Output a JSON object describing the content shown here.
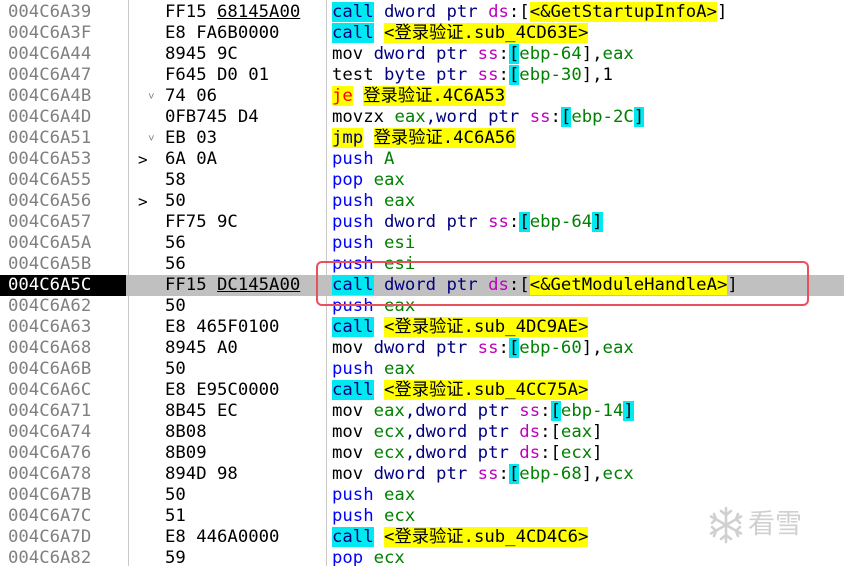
{
  "rows": [
    {
      "addr": "004C6A39",
      "mark": "",
      "bytes": [
        {
          "t": "FF15 "
        },
        {
          "t": "68145A00",
          "u": true
        }
      ],
      "dis": [
        {
          "c": "call",
          "s": "t-call"
        },
        {
          "c": " dword ptr ",
          "s": "t-ptr"
        },
        {
          "c": "ds",
          "s": "t-seg"
        },
        {
          "c": ":[",
          "s": "t-bkt"
        },
        {
          "c": "<&GetStartupInfoA>",
          "s": "t-sym"
        },
        {
          "c": "]",
          "s": "t-bkt"
        }
      ]
    },
    {
      "addr": "004C6A3F",
      "mark": "",
      "bytes": [
        {
          "t": "E8 FA6B0000"
        }
      ],
      "dis": [
        {
          "c": "call",
          "s": "t-call"
        },
        {
          "c": " ",
          "s": "t-plain"
        },
        {
          "c": "<登录验证.sub_4CD63E>",
          "s": "t-sym"
        }
      ]
    },
    {
      "addr": "004C6A44",
      "mark": "",
      "bytes": [
        {
          "t": "8945 9C"
        }
      ],
      "dis": [
        {
          "c": "mov",
          "s": "t-mov"
        },
        {
          "c": " dword ptr ",
          "s": "t-ptr"
        },
        {
          "c": "ss",
          "s": "t-seg"
        },
        {
          "c": ":",
          "s": "t-bkt"
        },
        {
          "c": "[",
          "s": "t-cyanbkt"
        },
        {
          "c": "ebp-64",
          "s": "t-reg"
        },
        {
          "c": "]",
          "s": "t-bkt"
        },
        {
          "c": ",",
          "s": "t-plain"
        },
        {
          "c": "eax",
          "s": "t-reg"
        }
      ]
    },
    {
      "addr": "004C6A47",
      "mark": "",
      "bytes": [
        {
          "t": "F645 D0 01"
        }
      ],
      "dis": [
        {
          "c": "test",
          "s": "t-test"
        },
        {
          "c": " byte ptr ",
          "s": "t-ptr"
        },
        {
          "c": "ss",
          "s": "t-seg"
        },
        {
          "c": ":",
          "s": "t-bkt"
        },
        {
          "c": "[",
          "s": "t-cyanbkt"
        },
        {
          "c": "ebp-30",
          "s": "t-reg"
        },
        {
          "c": "]",
          "s": "t-bkt"
        },
        {
          "c": ",1",
          "s": "t-plain"
        }
      ]
    },
    {
      "addr": "004C6A4B",
      "mark": "˅",
      "markcls": "jmpmark",
      "bytes": [
        {
          "t": "74 06"
        }
      ],
      "dis": [
        {
          "c": "je",
          "s": "t-je"
        },
        {
          "c": " ",
          "s": "t-plain"
        },
        {
          "c": "登录验证.4C6A53",
          "s": "t-sym"
        }
      ]
    },
    {
      "addr": "004C6A4D",
      "mark": "",
      "bytes": [
        {
          "t": "0FB745 D4"
        }
      ],
      "dis": [
        {
          "c": "movzx",
          "s": "t-mov"
        },
        {
          "c": " ",
          "s": "t-plain"
        },
        {
          "c": "eax",
          "s": "t-reg"
        },
        {
          "c": ",word ptr ",
          "s": "t-ptr"
        },
        {
          "c": "ss",
          "s": "t-seg"
        },
        {
          "c": ":",
          "s": "t-bkt"
        },
        {
          "c": "[",
          "s": "t-cyanbkt"
        },
        {
          "c": "ebp-2C",
          "s": "t-reg"
        },
        {
          "c": "]",
          "s": "t-cyanbkt"
        }
      ]
    },
    {
      "addr": "004C6A51",
      "mark": "˅",
      "markcls": "jmpmark",
      "bytes": [
        {
          "t": "EB 03"
        }
      ],
      "dis": [
        {
          "c": "jmp",
          "s": "t-jmp"
        },
        {
          "c": " ",
          "s": "t-plain"
        },
        {
          "c": "登录验证.4C6A56",
          "s": "t-sym"
        }
      ]
    },
    {
      "addr": "004C6A53",
      "mark": ">",
      "markcls": "target",
      "bytes": [
        {
          "t": "6A 0A"
        }
      ],
      "dis": [
        {
          "c": "push",
          "s": "t-push"
        },
        {
          "c": " ",
          "s": "t-plain"
        },
        {
          "c": "A",
          "s": "t-reg"
        }
      ]
    },
    {
      "addr": "004C6A55",
      "mark": "",
      "bytes": [
        {
          "t": "58"
        }
      ],
      "dis": [
        {
          "c": "pop",
          "s": "t-pop"
        },
        {
          "c": " ",
          "s": "t-plain"
        },
        {
          "c": "eax",
          "s": "t-reg"
        }
      ]
    },
    {
      "addr": "004C6A56",
      "mark": ">",
      "markcls": "target",
      "bytes": [
        {
          "t": "50"
        }
      ],
      "dis": [
        {
          "c": "push",
          "s": "t-push"
        },
        {
          "c": " ",
          "s": "t-plain"
        },
        {
          "c": "eax",
          "s": "t-reg"
        }
      ]
    },
    {
      "addr": "004C6A57",
      "mark": "",
      "bytes": [
        {
          "t": "FF75 9C"
        }
      ],
      "dis": [
        {
          "c": "push",
          "s": "t-push"
        },
        {
          "c": " dword ptr ",
          "s": "t-ptr"
        },
        {
          "c": "ss",
          "s": "t-seg"
        },
        {
          "c": ":",
          "s": "t-bkt"
        },
        {
          "c": "[",
          "s": "t-cyanbkt"
        },
        {
          "c": "ebp-64",
          "s": "t-reg"
        },
        {
          "c": "]",
          "s": "t-cyanbkt"
        }
      ]
    },
    {
      "addr": "004C6A5A",
      "mark": "",
      "bytes": [
        {
          "t": "56"
        }
      ],
      "dis": [
        {
          "c": "push",
          "s": "t-push"
        },
        {
          "c": " ",
          "s": "t-plain"
        },
        {
          "c": "esi",
          "s": "t-reg"
        }
      ]
    },
    {
      "addr": "004C6A5B",
      "mark": "",
      "bytes": [
        {
          "t": "56"
        }
      ],
      "dis": [
        {
          "c": "push",
          "s": "t-push"
        },
        {
          "c": " ",
          "s": "t-plain"
        },
        {
          "c": "esi",
          "s": "t-reg"
        }
      ]
    },
    {
      "addr": "004C6A5C",
      "mark": "",
      "current": true,
      "bytes": [
        {
          "t": "FF15 "
        },
        {
          "t": "DC145A00",
          "u": true
        }
      ],
      "dis": [
        {
          "c": "call",
          "s": "t-call"
        },
        {
          "c": " dword ptr ",
          "s": "t-ptr"
        },
        {
          "c": "ds",
          "s": "t-seg"
        },
        {
          "c": ":[",
          "s": "t-bkt"
        },
        {
          "c": "<&GetModuleHandleA>",
          "s": "t-sym"
        },
        {
          "c": "]",
          "s": "t-bkt"
        }
      ]
    },
    {
      "addr": "004C6A62",
      "mark": "",
      "bytes": [
        {
          "t": "50"
        }
      ],
      "dis": [
        {
          "c": "push",
          "s": "t-push"
        },
        {
          "c": " ",
          "s": "t-plain"
        },
        {
          "c": "eax",
          "s": "t-reg"
        }
      ]
    },
    {
      "addr": "004C6A63",
      "mark": "",
      "bytes": [
        {
          "t": "E8 465F0100"
        }
      ],
      "dis": [
        {
          "c": "call",
          "s": "t-call"
        },
        {
          "c": " ",
          "s": "t-plain"
        },
        {
          "c": "<登录验证.sub_4DC9AE>",
          "s": "t-sym"
        }
      ]
    },
    {
      "addr": "004C6A68",
      "mark": "",
      "bytes": [
        {
          "t": "8945 A0"
        }
      ],
      "dis": [
        {
          "c": "mov",
          "s": "t-mov"
        },
        {
          "c": " dword ptr ",
          "s": "t-ptr"
        },
        {
          "c": "ss",
          "s": "t-seg"
        },
        {
          "c": ":",
          "s": "t-bkt"
        },
        {
          "c": "[",
          "s": "t-cyanbkt"
        },
        {
          "c": "ebp-60",
          "s": "t-reg"
        },
        {
          "c": "]",
          "s": "t-bkt"
        },
        {
          "c": ",",
          "s": "t-plain"
        },
        {
          "c": "eax",
          "s": "t-reg"
        }
      ]
    },
    {
      "addr": "004C6A6B",
      "mark": "",
      "bytes": [
        {
          "t": "50"
        }
      ],
      "dis": [
        {
          "c": "push",
          "s": "t-push"
        },
        {
          "c": " ",
          "s": "t-plain"
        },
        {
          "c": "eax",
          "s": "t-reg"
        }
      ]
    },
    {
      "addr": "004C6A6C",
      "mark": "",
      "bytes": [
        {
          "t": "E8 E95C0000"
        }
      ],
      "dis": [
        {
          "c": "call",
          "s": "t-call"
        },
        {
          "c": " ",
          "s": "t-plain"
        },
        {
          "c": "<登录验证.sub_4CC75A>",
          "s": "t-sym"
        }
      ]
    },
    {
      "addr": "004C6A71",
      "mark": "",
      "bytes": [
        {
          "t": "8B45 EC"
        }
      ],
      "dis": [
        {
          "c": "mov",
          "s": "t-mov"
        },
        {
          "c": " ",
          "s": "t-plain"
        },
        {
          "c": "eax",
          "s": "t-reg"
        },
        {
          "c": ",dword ptr ",
          "s": "t-ptr"
        },
        {
          "c": "ss",
          "s": "t-seg"
        },
        {
          "c": ":",
          "s": "t-bkt"
        },
        {
          "c": "[",
          "s": "t-cyanbkt"
        },
        {
          "c": "ebp-14",
          "s": "t-reg"
        },
        {
          "c": "]",
          "s": "t-cyanbkt"
        }
      ]
    },
    {
      "addr": "004C6A74",
      "mark": "",
      "bytes": [
        {
          "t": "8B08"
        }
      ],
      "dis": [
        {
          "c": "mov",
          "s": "t-mov"
        },
        {
          "c": " ",
          "s": "t-plain"
        },
        {
          "c": "ecx",
          "s": "t-reg"
        },
        {
          "c": ",dword ptr ",
          "s": "t-ptr"
        },
        {
          "c": "ds",
          "s": "t-seg"
        },
        {
          "c": ":[",
          "s": "t-bkt"
        },
        {
          "c": "eax",
          "s": "t-reg"
        },
        {
          "c": "]",
          "s": "t-bkt"
        }
      ]
    },
    {
      "addr": "004C6A76",
      "mark": "",
      "bytes": [
        {
          "t": "8B09"
        }
      ],
      "dis": [
        {
          "c": "mov",
          "s": "t-mov"
        },
        {
          "c": " ",
          "s": "t-plain"
        },
        {
          "c": "ecx",
          "s": "t-reg"
        },
        {
          "c": ",dword ptr ",
          "s": "t-ptr"
        },
        {
          "c": "ds",
          "s": "t-seg"
        },
        {
          "c": ":[",
          "s": "t-bkt"
        },
        {
          "c": "ecx",
          "s": "t-reg"
        },
        {
          "c": "]",
          "s": "t-bkt"
        }
      ]
    },
    {
      "addr": "004C6A78",
      "mark": "",
      "bytes": [
        {
          "t": "894D 98"
        }
      ],
      "dis": [
        {
          "c": "mov",
          "s": "t-mov"
        },
        {
          "c": " dword ptr ",
          "s": "t-ptr"
        },
        {
          "c": "ss",
          "s": "t-seg"
        },
        {
          "c": ":",
          "s": "t-bkt"
        },
        {
          "c": "[",
          "s": "t-cyanbkt"
        },
        {
          "c": "ebp-68",
          "s": "t-reg"
        },
        {
          "c": "]",
          "s": "t-bkt"
        },
        {
          "c": ",",
          "s": "t-plain"
        },
        {
          "c": "ecx",
          "s": "t-reg"
        }
      ]
    },
    {
      "addr": "004C6A7B",
      "mark": "",
      "bytes": [
        {
          "t": "50"
        }
      ],
      "dis": [
        {
          "c": "push",
          "s": "t-push"
        },
        {
          "c": " ",
          "s": "t-plain"
        },
        {
          "c": "eax",
          "s": "t-reg"
        }
      ]
    },
    {
      "addr": "004C6A7C",
      "mark": "",
      "bytes": [
        {
          "t": "51"
        }
      ],
      "dis": [
        {
          "c": "push",
          "s": "t-push"
        },
        {
          "c": " ",
          "s": "t-plain"
        },
        {
          "c": "ecx",
          "s": "t-reg"
        }
      ]
    },
    {
      "addr": "004C6A7D",
      "mark": "",
      "bytes": [
        {
          "t": "E8 446A0000"
        }
      ],
      "dis": [
        {
          "c": "call",
          "s": "t-call"
        },
        {
          "c": " ",
          "s": "t-plain"
        },
        {
          "c": "<登录验证.sub_4CD4C6>",
          "s": "t-sym"
        }
      ]
    },
    {
      "addr": "004C6A82",
      "mark": "",
      "bytes": [
        {
          "t": "59"
        }
      ],
      "dis": [
        {
          "c": "pop",
          "s": "t-pop"
        },
        {
          "c": " ",
          "s": "t-plain"
        },
        {
          "c": "ecx",
          "s": "t-reg"
        }
      ]
    }
  ],
  "watermark": {
    "text": "看雪",
    "icon": "snowflake-icon"
  },
  "colors": {
    "call_bg": "#00e8f0",
    "symbol_bg": "#ffff00",
    "register": "#008000",
    "segment": "#c000c0",
    "highlight_box": "#e8505c"
  }
}
